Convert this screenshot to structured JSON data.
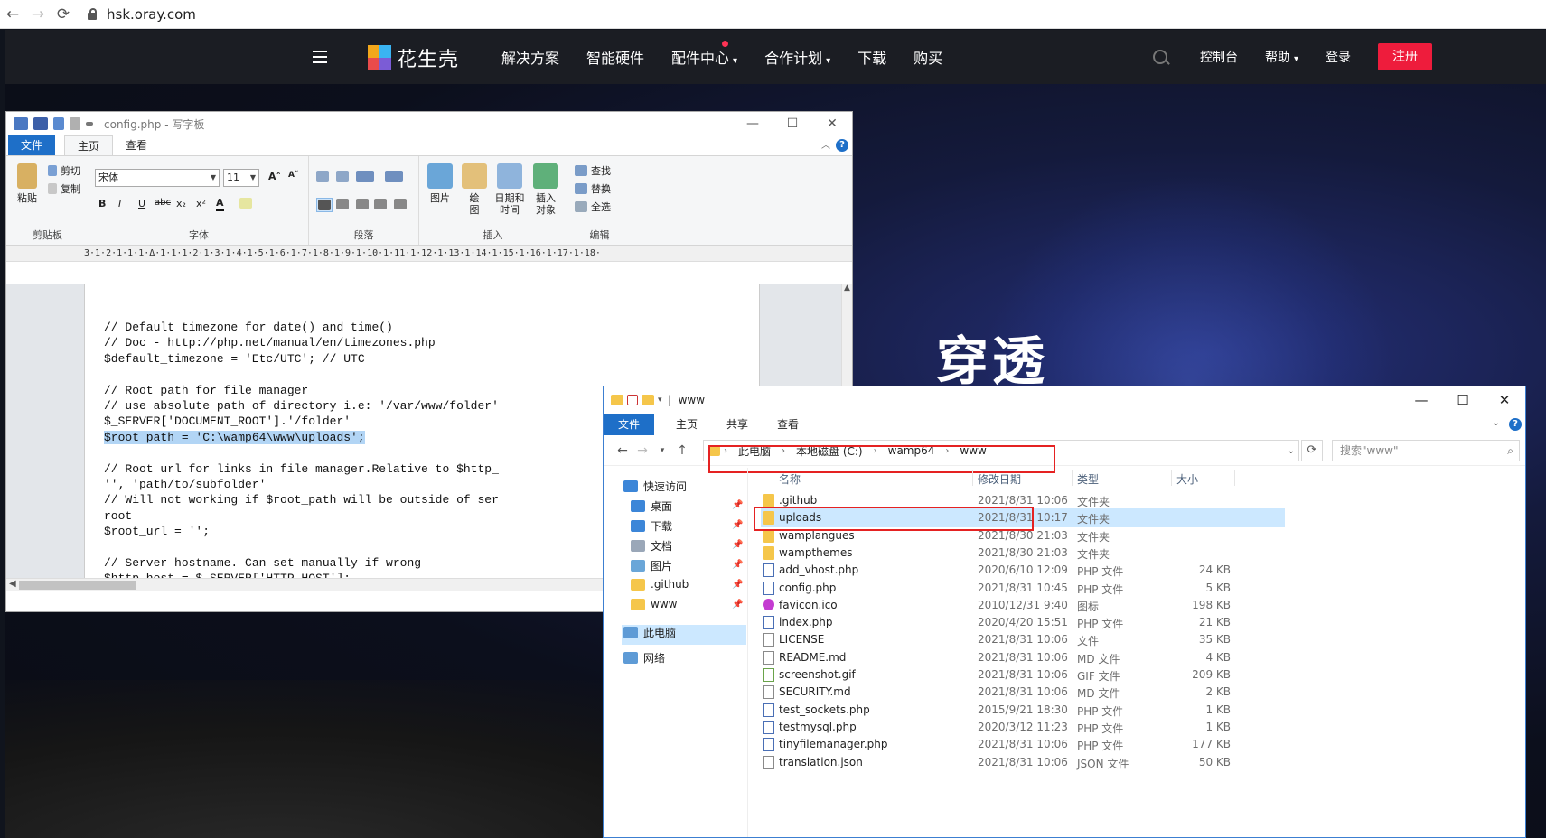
{
  "browser": {
    "back": "←",
    "forward": "→",
    "reload": "⟳",
    "url": "hsk.oray.com"
  },
  "site": {
    "logo_text": "花生壳",
    "nav": [
      "解决方案",
      "智能硬件",
      "配件中心",
      "合作计划",
      "下载",
      "购买"
    ],
    "nav_caret": "▾",
    "console": "控制台",
    "help": "帮助",
    "login": "登录",
    "register": "注册",
    "hero": "穿透",
    "colors": {
      "header_bg": "#1b1d23",
      "register_btn": "#ee1c3c",
      "dot": "#ff3355"
    }
  },
  "wordpad": {
    "title": "config.php - 写字板",
    "min": "—",
    "max": "☐",
    "close": "✕",
    "tabs": {
      "file": "文件",
      "home": "主页",
      "view": "查看"
    },
    "help_icon": "?",
    "collapse": "︿",
    "clipboard": {
      "paste": "粘贴",
      "cut": "剪切",
      "copy": "复制",
      "group": "剪贴板"
    },
    "font": {
      "family": "宋体",
      "size": "11",
      "group": "字体",
      "bold": "B",
      "italic": "I",
      "underline": "U",
      "strike": "abc",
      "sub": "x₂",
      "sup": "x²",
      "color": "A",
      "grow": "A˄",
      "shrink": "A˅"
    },
    "paragraph": {
      "group": "段落"
    },
    "insert": {
      "picture": "图片",
      "draw": "绘\n图",
      "datetime": "日期和\n时间",
      "object": "插入\n对象",
      "group": "插入"
    },
    "edit": {
      "find": "查找",
      "replace": "替换",
      "select_all": "全选",
      "group": "编辑"
    },
    "ruler": "3·1·2·1·1·1·Δ·1·1·1·2·1·3·1·4·1·5·1·6·1·7·1·8·1·9·1·10·1·11·1·12·1·13·1·14·1·15·1·16·1·17·1·18·",
    "code_lines": [
      "// Default timezone for date() and time()",
      "// Doc - http://php.net/manual/en/timezones.php",
      "$default_timezone = 'Etc/UTC'; // UTC",
      "",
      "// Root path for file manager",
      "// use absolute path of directory i.e: '/var/www/folder'",
      "$_SERVER['DOCUMENT_ROOT'].'/folder'",
      "$root_path = 'C:\\wamp64\\www\\uploads';",
      "",
      "// Root url for links in file manager.Relative to $http_",
      "'', 'path/to/subfolder'",
      "// Will not working if $root_path will be outside of ser",
      "root",
      "$root_url = '';",
      "",
      "// Server hostname. Can set manually if wrong",
      "$http_host = $_SERVER['HTTP_HOST'];"
    ],
    "highlighted_line": 7
  },
  "explorer": {
    "title": "www",
    "min": "—",
    "max": "☐",
    "close": "✕",
    "tabs": {
      "file": "文件",
      "home": "主页",
      "share": "共享",
      "view": "查看"
    },
    "help_icon": "?",
    "breadcrumb": [
      "此电脑",
      "本地磁盘 (C:)",
      "wamp64",
      "www"
    ],
    "search_placeholder": "搜索\"www\"",
    "columns": {
      "name": "名称",
      "date": "修改日期",
      "type": "类型",
      "size": "大小"
    },
    "nav_pane": [
      {
        "label": "快速访问",
        "icon": "star-icon",
        "pinned": false
      },
      {
        "label": "桌面",
        "icon": "desktop-icon",
        "pinned": true
      },
      {
        "label": "下载",
        "icon": "download-icon",
        "pinned": true
      },
      {
        "label": "文档",
        "icon": "documents-icon",
        "pinned": true
      },
      {
        "label": "图片",
        "icon": "pictures-icon",
        "pinned": true
      },
      {
        "label": ".github",
        "icon": "folder-icon",
        "pinned": true
      },
      {
        "label": "www",
        "icon": "folder-icon",
        "pinned": true
      },
      {
        "label": "此电脑",
        "icon": "computer-icon",
        "pinned": false
      },
      {
        "label": "网络",
        "icon": "network-icon",
        "pinned": false
      }
    ],
    "files": [
      {
        "name": ".github",
        "date": "2021/8/31 10:06",
        "type": "文件夹",
        "size": "",
        "kind": "folder"
      },
      {
        "name": "uploads",
        "date": "2021/8/31 10:17",
        "type": "文件夹",
        "size": "",
        "kind": "folder",
        "selected": true
      },
      {
        "name": "wamplangues",
        "date": "2021/8/30 21:03",
        "type": "文件夹",
        "size": "",
        "kind": "folder"
      },
      {
        "name": "wampthemes",
        "date": "2021/8/30 21:03",
        "type": "文件夹",
        "size": "",
        "kind": "folder"
      },
      {
        "name": "add_vhost.php",
        "date": "2020/6/10 12:09",
        "type": "PHP 文件",
        "size": "24 KB",
        "kind": "php"
      },
      {
        "name": "config.php",
        "date": "2021/8/31 10:45",
        "type": "PHP 文件",
        "size": "5 KB",
        "kind": "php"
      },
      {
        "name": "favicon.ico",
        "date": "2010/12/31 9:40",
        "type": "图标",
        "size": "198 KB",
        "kind": "ico"
      },
      {
        "name": "index.php",
        "date": "2020/4/20 15:51",
        "type": "PHP 文件",
        "size": "21 KB",
        "kind": "php"
      },
      {
        "name": "LICENSE",
        "date": "2021/8/31 10:06",
        "type": "文件",
        "size": "35 KB",
        "kind": "file"
      },
      {
        "name": "README.md",
        "date": "2021/8/31 10:06",
        "type": "MD 文件",
        "size": "4 KB",
        "kind": "file"
      },
      {
        "name": "screenshot.gif",
        "date": "2021/8/31 10:06",
        "type": "GIF 文件",
        "size": "209 KB",
        "kind": "gif"
      },
      {
        "name": "SECURITY.md",
        "date": "2021/8/31 10:06",
        "type": "MD 文件",
        "size": "2 KB",
        "kind": "file"
      },
      {
        "name": "test_sockets.php",
        "date": "2015/9/21 18:30",
        "type": "PHP 文件",
        "size": "1 KB",
        "kind": "php"
      },
      {
        "name": "testmysql.php",
        "date": "2020/3/12 11:23",
        "type": "PHP 文件",
        "size": "1 KB",
        "kind": "php"
      },
      {
        "name": "tinyfilemanager.php",
        "date": "2021/8/31 10:06",
        "type": "PHP 文件",
        "size": "177 KB",
        "kind": "php"
      },
      {
        "name": "translation.json",
        "date": "2021/8/31 10:06",
        "type": "JSON 文件",
        "size": "50 KB",
        "kind": "file"
      }
    ]
  }
}
